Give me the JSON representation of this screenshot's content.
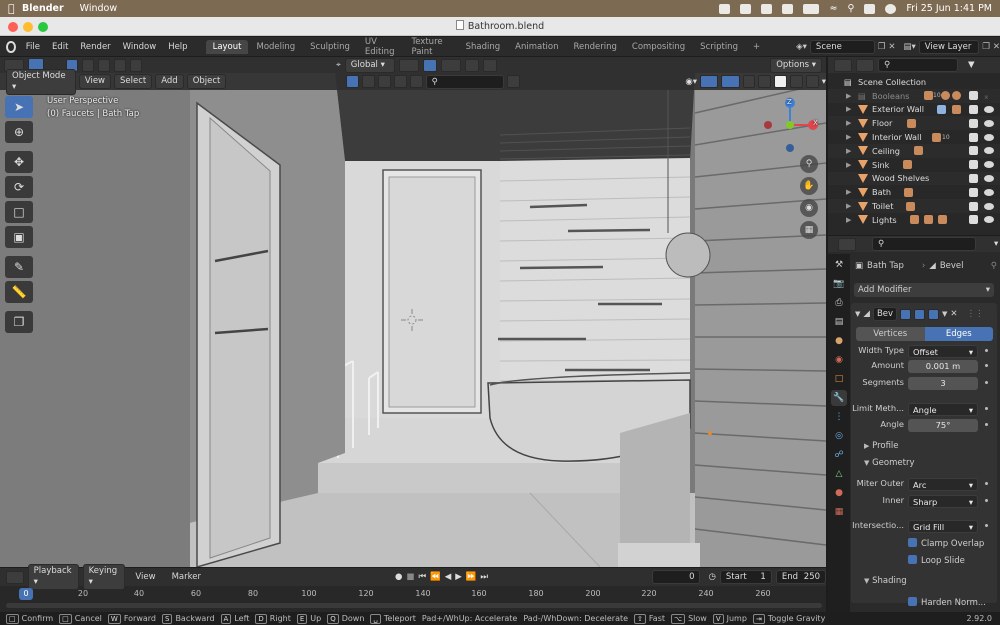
{
  "mac_menubar": {
    "app_name": "Blender",
    "menus": [
      "Window"
    ],
    "datetime": "Fri 25 Jun  1:41 PM"
  },
  "window": {
    "title": "Bathroom.blend"
  },
  "top_menu": {
    "items": [
      "File",
      "Edit",
      "Render",
      "Window",
      "Help"
    ]
  },
  "workspace_tabs": [
    "Layout",
    "Modeling",
    "Sculpting",
    "UV Editing",
    "Texture Paint",
    "Shading",
    "Animation",
    "Rendering",
    "Compositing",
    "Scripting"
  ],
  "active_tab": "Layout",
  "scene": {
    "name": "Scene",
    "view_layer": "View Layer"
  },
  "viewport_header": {
    "mode": "Object Mode",
    "menus": [
      "View",
      "Select",
      "Add",
      "Object"
    ],
    "orientation": "Global",
    "options_label": "Options"
  },
  "viewport": {
    "perspective": "User Perspective",
    "selection": "(0) Faucets | Bath Tap"
  },
  "gizmo": {
    "x": "X",
    "y": "Y",
    "z": "Z",
    "x_color": "#e0464d",
    "y_color": "#82c928",
    "z_color": "#3d81d8"
  },
  "outliner": {
    "root": "Scene Collection",
    "items": [
      {
        "label": "Booleans",
        "dim": true
      },
      {
        "label": "Exterior Wall"
      },
      {
        "label": "Floor"
      },
      {
        "label": "Interior Wall"
      },
      {
        "label": "Ceiling"
      },
      {
        "label": "Sink"
      },
      {
        "label": "Wood Shelves"
      },
      {
        "label": "Bath"
      },
      {
        "label": "Toilet"
      },
      {
        "label": "Lights"
      }
    ],
    "badges": {
      "booleans": "10",
      "interior_wall": "10"
    }
  },
  "properties": {
    "object": "Bath Tap",
    "modifier_name_header": "Bevel",
    "add_modifier": "Add Modifier",
    "modifier_short": "Bev",
    "affect": {
      "vertices": "Vertices",
      "edges": "Edges",
      "active": "Edges"
    },
    "fields": [
      {
        "label": "Width Type",
        "value": "Offset",
        "type": "dropdown"
      },
      {
        "label": "Amount",
        "value": "0.001 m",
        "type": "number"
      },
      {
        "label": "Segments",
        "value": "3",
        "type": "number"
      },
      {
        "label": "Limit Meth...",
        "value": "Angle",
        "type": "dropdown"
      },
      {
        "label": "Angle",
        "value": "75°",
        "type": "number"
      }
    ],
    "profile": "Profile",
    "geometry": "Geometry",
    "geometry_fields": [
      {
        "label": "Miter Outer",
        "value": "Arc"
      },
      {
        "label": "Inner",
        "value": "Sharp"
      },
      {
        "label": "Intersectio...",
        "value": "Grid Fill"
      }
    ],
    "clamp_overlap": "Clamp Overlap",
    "loop_slide": "Loop Slide",
    "shading": "Shading",
    "harden_normals": "Harden Norm..."
  },
  "timeline": {
    "menus": [
      "Playback",
      "Keying",
      "View",
      "Marker"
    ],
    "current_frame": "0",
    "start_label": "Start",
    "start": "1",
    "end_label": "End",
    "end": "250",
    "ruler_current": "0",
    "ruler": [
      "20",
      "40",
      "60",
      "80",
      "100",
      "120",
      "140",
      "160",
      "180",
      "200",
      "220",
      "240",
      "260"
    ]
  },
  "statusbar": {
    "items": [
      {
        "key": "",
        "label": "Confirm"
      },
      {
        "key": "",
        "label": "Cancel"
      },
      {
        "key": "W",
        "label": "Forward"
      },
      {
        "key": "S",
        "label": "Backward"
      },
      {
        "key": "A",
        "label": "Left"
      },
      {
        "key": "D",
        "label": "Right"
      },
      {
        "key": "E",
        "label": "Up"
      },
      {
        "key": "Q",
        "label": "Down"
      },
      {
        "key": "",
        "label": "Teleport"
      },
      {
        "key": "",
        "label": "Pad+/WhUp: Accelerate"
      },
      {
        "key": "",
        "label": "Pad-/WhDown: Decelerate"
      },
      {
        "key": "",
        "label": "Fast"
      },
      {
        "key": "",
        "label": "Slow"
      },
      {
        "key": "",
        "label": "Jump"
      },
      {
        "key": "",
        "label": "Toggle Gravity"
      }
    ],
    "version": "2.92.0"
  },
  "colors": {
    "accent": "#4772b3",
    "mac_bar": "#7c6a52"
  }
}
